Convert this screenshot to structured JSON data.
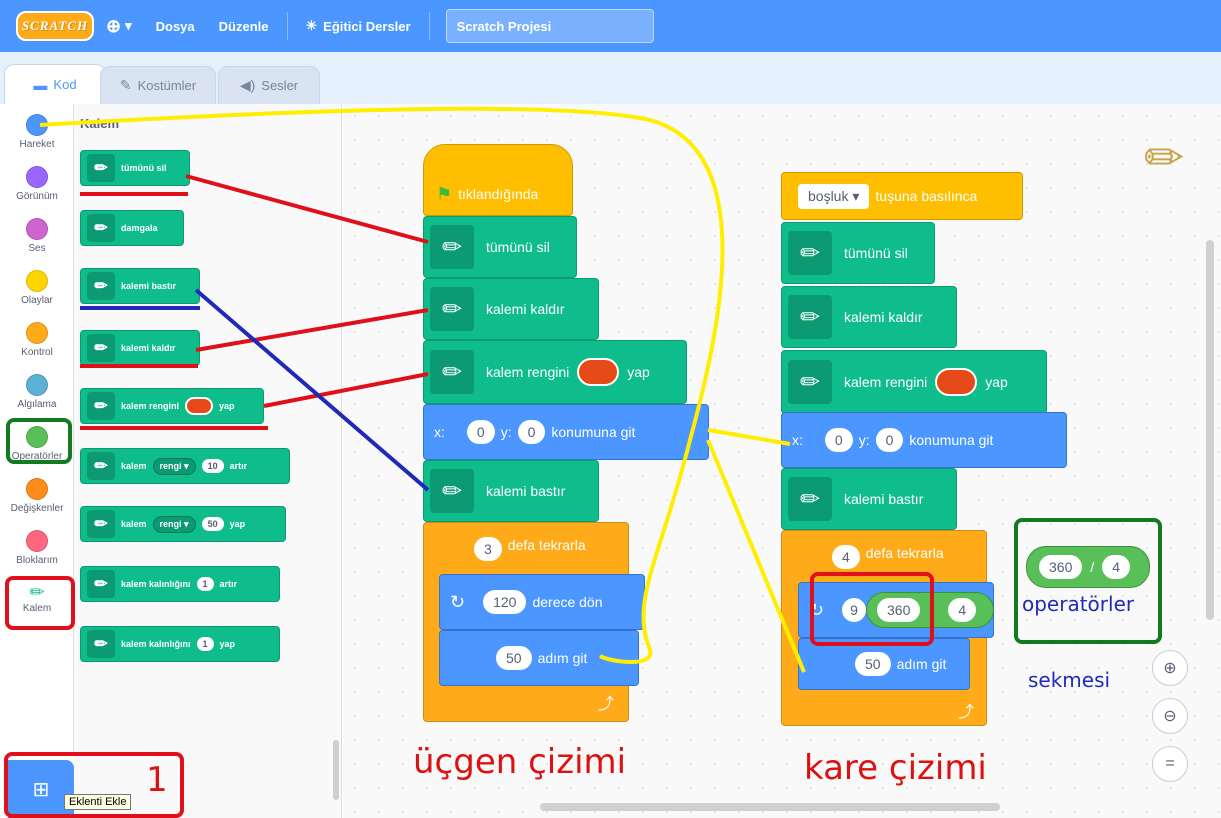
{
  "menubar": {
    "logo": "SCRATCH",
    "file": "Dosya",
    "edit": "Düzenle",
    "tutorials": "Eğitici Dersler",
    "project_title": "Scratch Projesi"
  },
  "tabs": {
    "code": "Kod",
    "costumes": "Kostümler",
    "sounds": "Sesler"
  },
  "categories": [
    {
      "label": "Hareket",
      "color": "#4c97ff"
    },
    {
      "label": "Görünüm",
      "color": "#9966ff"
    },
    {
      "label": "Ses",
      "color": "#cf63cf"
    },
    {
      "label": "Olaylar",
      "color": "#ffd500"
    },
    {
      "label": "Kontrol",
      "color": "#ffab19"
    },
    {
      "label": "Algılama",
      "color": "#5cb1d6"
    },
    {
      "label": "Operatörler",
      "color": "#59c059"
    },
    {
      "label": "Değişkenler",
      "color": "#ff8c1a"
    },
    {
      "label": "Bloklarım",
      "color": "#ff6680"
    },
    {
      "label": "Kalem",
      "color": "#0fbd8c"
    }
  ],
  "palette": {
    "title": "Kalem",
    "blocks": {
      "clear": "tümünü sil",
      "stamp": "damgala",
      "pen_down": "kalemi bastır",
      "pen_up": "kalemi kaldır",
      "set_color_a": "kalem rengini",
      "set_color_b": "yap",
      "change_pen": "kalem",
      "change_dropdown": "rengi ▾",
      "change_value": "10",
      "change_suffix": "artır",
      "set_pen": "kalem",
      "set_dropdown": "rengi ▾",
      "set_value": "50",
      "set_suffix": "yap",
      "change_size": "kalem kalınlığını",
      "change_size_value": "1",
      "change_size_suffix": "artır",
      "set_size": "kalem kalınlığını",
      "set_size_value": "1",
      "set_size_suffix": "yap"
    }
  },
  "script_triangle": {
    "hat": "tıklandığında",
    "clear": "tümünü sil",
    "pen_up": "kalemi kaldır",
    "color_a": "kalem rengini",
    "color_b": "yap",
    "x_label": "x:",
    "x_value": "0",
    "y_label": "y:",
    "y_value": "0",
    "goto": "konumuna git",
    "pen_down": "kalemi bastır",
    "repeat_value": "3",
    "repeat_label": "defa tekrarla",
    "turn_value": "120",
    "turn_label": "derece dön",
    "move_value": "50",
    "move_label": "adım git",
    "caption": "üçgen çizimi"
  },
  "script_square": {
    "key": "boşluk ▾",
    "hat": "tuşuna basılınca",
    "clear": "tümünü sil",
    "pen_up": "kalemi kaldır",
    "color_a": "kalem rengini",
    "color_b": "yap",
    "x_label": "x:",
    "x_value": "0",
    "y_label": "y:",
    "y_value": "0",
    "goto": "konumuna git",
    "pen_down": "kalemi bastır",
    "repeat_value": "4",
    "repeat_label": "defa tekrarla",
    "op_left": "360",
    "op_right": "4",
    "move_value": "50",
    "move_label": "adım git",
    "caption": "kare çizimi",
    "hidden_digit": "9"
  },
  "operator_sample": {
    "left": "360",
    "sign": "/",
    "right": "4",
    "label": "operatörler",
    "label2": "sekmesi"
  },
  "annotation": {
    "number_one": "1",
    "tooltip": "Eklenti Ekle"
  },
  "colors": {
    "menubar": "#4c97ff",
    "pen": "#0fbd8c",
    "event": "#ffbf00",
    "motion": "#4c97ff",
    "control": "#ffab19",
    "operators": "#59c059",
    "annotation_red": "#e0101a",
    "annotation_green": "#137a22",
    "annotation_yellow": "#ffee00",
    "annotation_blue": "#1f2bb8"
  }
}
